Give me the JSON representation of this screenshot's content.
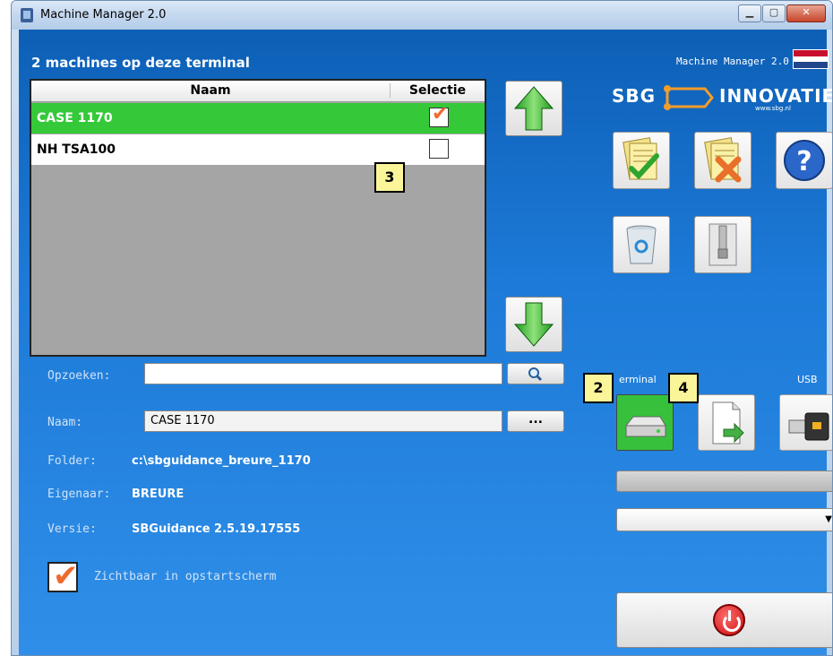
{
  "window": {
    "title": "Machine Manager 2.0"
  },
  "header": {
    "machines_title": "2 machines op deze terminal",
    "version_label": "Machine Manager 2.0"
  },
  "table": {
    "headers": [
      "Naam",
      "Selectie"
    ],
    "rows": [
      {
        "name": "CASE 1170",
        "selected": true
      },
      {
        "name": "NH TSA100",
        "selected": false
      }
    ]
  },
  "badges": [
    "3",
    "2",
    "4"
  ],
  "logo": {
    "sbg": "SBG",
    "innovatie": "INNOVATIE",
    "url": "www.sbg.nl"
  },
  "form": {
    "search_label": "Opzoeken:",
    "search_value": "",
    "naam_label": "Naam:",
    "naam_value": "CASE 1170",
    "browse_label": "...",
    "folder_label": "Folder:",
    "folder_value": "c:\\sbguidance_breure_1170",
    "owner_label": "Eigenaar:",
    "owner_value": "BREURE",
    "version_label": "Versie:",
    "version_value": "SBGuidance 2.5.19.17555",
    "visible_label": "Zichtbaar in opstartscherm",
    "visible_checked": true
  },
  "transfer": {
    "terminal_label": "erminal",
    "usb_label": "USB"
  },
  "progress": {
    "value": 0
  },
  "dropdown": {
    "value": ""
  },
  "colors": {
    "accent_green": "#35c93a",
    "background_blue": "#1d7ad8",
    "check_orange": "#ef6a2d",
    "badge_yellow": "#fbf59a"
  },
  "icons": [
    "up-arrow-icon",
    "down-arrow-icon",
    "accept-document-icon",
    "reject-document-icon",
    "help-icon",
    "recycle-bin-icon",
    "archive-zip-icon",
    "terminal-drive-icon",
    "transfer-document-icon",
    "usb-drive-icon",
    "search-icon",
    "power-icon"
  ]
}
